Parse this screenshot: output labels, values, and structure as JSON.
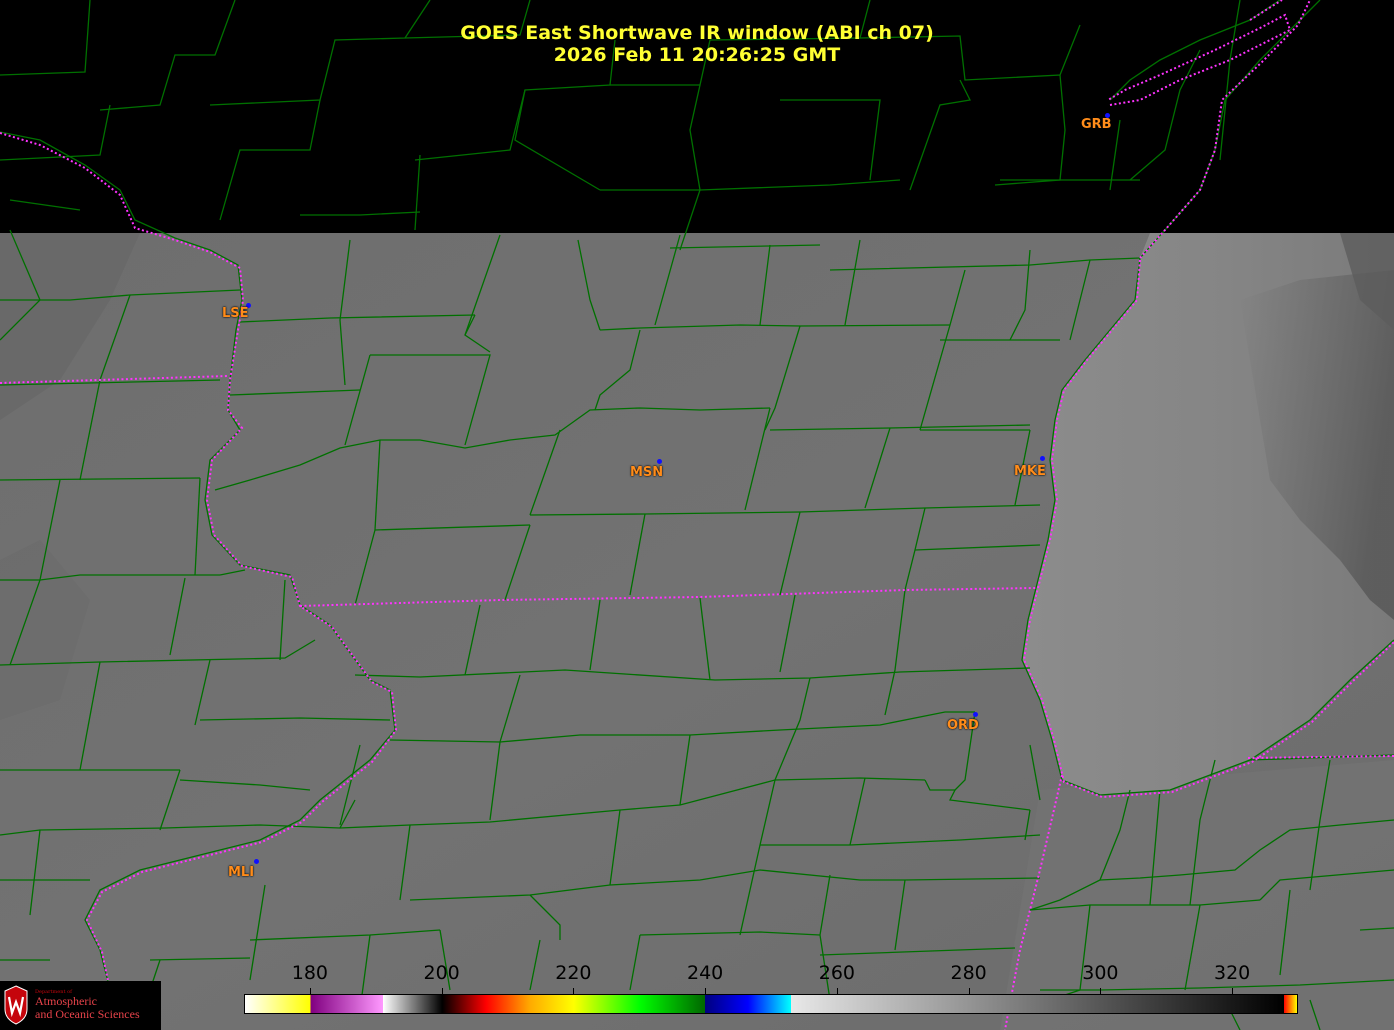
{
  "title": {
    "line1": "GOES East Shortwave IR window (ABI ch 07)",
    "line2": "2026 Feb 11  20:26:25 GMT"
  },
  "colors": {
    "title_text": "#ffff33",
    "city_label": "#ff8c1a",
    "city_label_outline": "#000000",
    "county_lines": "#007000",
    "state_lines": "#ff33ff",
    "station_dot": "#1010ff",
    "no_data": "#000000"
  },
  "cities": [
    {
      "label": "GRB"
    },
    {
      "label": "LSE"
    },
    {
      "label": "MSN"
    },
    {
      "label": "MKE"
    },
    {
      "label": "ORD"
    },
    {
      "label": "MLI"
    }
  ],
  "colorbar": {
    "ticks": [
      "180",
      "200",
      "220",
      "240",
      "260",
      "280",
      "300",
      "320"
    ],
    "segments": [
      {
        "to": 180,
        "colors": [
          "#ffffff",
          "#ffff00"
        ]
      },
      {
        "to": 191,
        "colors": [
          "#800080",
          "#ff99ff"
        ]
      },
      {
        "to": 200,
        "colors": [
          "#ffffff",
          "#000000"
        ]
      },
      {
        "to": 220,
        "colors": [
          "#000000",
          "#ff0000",
          "#ffaa00",
          "#ffff00"
        ]
      },
      {
        "to": 240,
        "colors": [
          "#ffff00",
          "#00ff00",
          "#006600"
        ]
      },
      {
        "to": 253,
        "colors": [
          "#000080",
          "#0000ff",
          "#00ffff"
        ]
      },
      {
        "to": 328,
        "colors": [
          "#e8e8e8",
          "#000000"
        ]
      },
      {
        "to": 330,
        "colors": [
          "#ff0000",
          "#ffff00"
        ]
      }
    ],
    "min": 170,
    "max": 330
  },
  "logo": {
    "dept": "Department of",
    "line1": "Atmospheric",
    "line2": "and Oceanic Sciences",
    "seal": "uw-crest-icon"
  }
}
